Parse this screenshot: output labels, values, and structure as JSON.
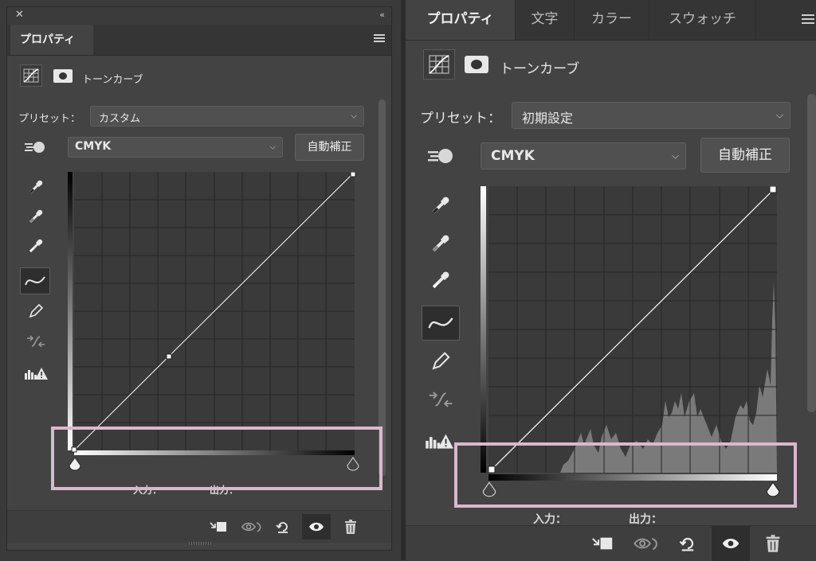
{
  "left": {
    "close_glyph": "✕",
    "collapse_glyph": "‹‹",
    "tab_label": "プロパティ",
    "title": "トーンカーブ",
    "preset_label": "プリセット：",
    "preset_value": "カスタム",
    "channel_value": "CMYK",
    "auto_button": "自動補正",
    "input_label": "入力：",
    "output_label": "出力："
  },
  "right": {
    "tabs": [
      {
        "label": "プロパティ"
      },
      {
        "label": "文字"
      },
      {
        "label": "カラー"
      },
      {
        "label": "スウォッチ"
      }
    ],
    "title": "トーンカーブ",
    "preset_label": "プリセット：",
    "preset_value": "初期設定",
    "channel_value": "CMYK",
    "auto_button": "自動補正",
    "input_label": "入力：",
    "output_label": "出力："
  },
  "colors": {
    "panel_bg": "#434343",
    "highlight_border": "#d9b8cf",
    "curve": "#ffffff",
    "histogram": "#7a7a7a"
  }
}
